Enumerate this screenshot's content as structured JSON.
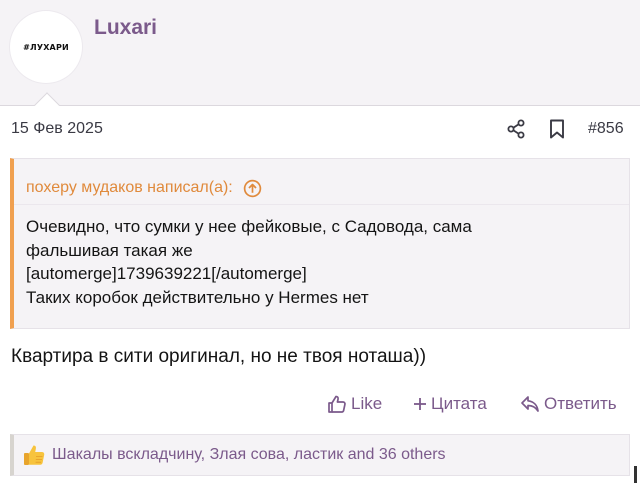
{
  "post": {
    "username": "Luxari",
    "avatar_text": "#ЛУХАРИ",
    "date": "15 Фев 2025",
    "number": "#856"
  },
  "quote": {
    "author": "похеру мудаков написал(а):",
    "lines": [
      "Очевидно, что сумки у нее фейковые, с Садовода, сама",
      "фальшивая такая же",
      "[automerge]1739639221[/automerge]",
      "Таких коробок действительно у Hermes нет"
    ]
  },
  "message": "Квартира в сити оригинал, но не твоя ноташа))",
  "actions": {
    "like": "Like",
    "quote": "Цитата",
    "reply": "Ответить"
  },
  "reactions": {
    "text": "Шакалы вскладчину, Злая сова, ластик and 36 others"
  },
  "colors": {
    "accent": "#7b5a8b",
    "quote_border": "#f0a050",
    "quote_author": "#e08a3c",
    "panel_bg": "#f5f3f6"
  },
  "icons": {
    "share": "share-icon",
    "bookmark": "bookmark-icon",
    "quote_arrow": "arrow-up-circle-icon",
    "like": "thumbs-up-icon",
    "quote_action": "plus-icon",
    "reply": "reply-icon",
    "reaction": "thumbs-up-emoji-icon"
  }
}
